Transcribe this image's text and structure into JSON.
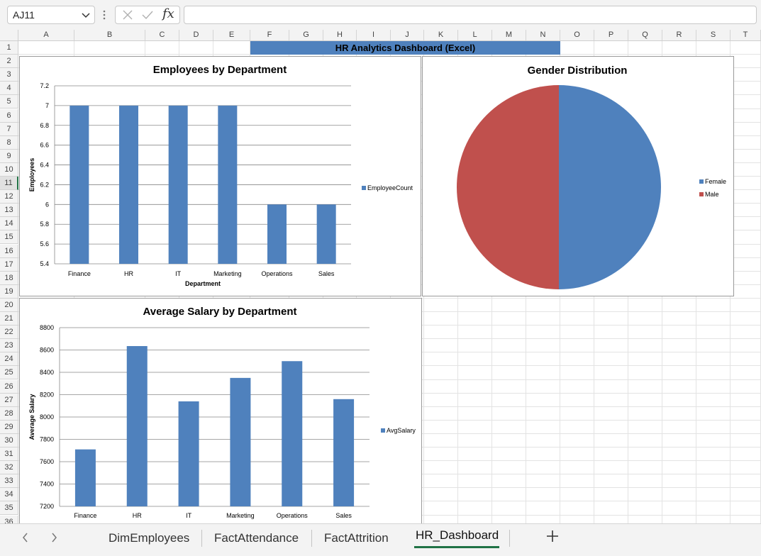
{
  "formula_bar": {
    "name_box": "AJ11",
    "fx_label": "fx",
    "formula": ""
  },
  "columns": [
    "A",
    "B",
    "C",
    "D",
    "E",
    "F",
    "G",
    "H",
    "I",
    "J",
    "K",
    "L",
    "M",
    "N",
    "O",
    "P",
    "Q",
    "R",
    "S",
    "T"
  ],
  "rows": [
    "1",
    "2",
    "3",
    "4",
    "5",
    "6",
    "7",
    "8",
    "9",
    "10",
    "11",
    "12",
    "13",
    "14",
    "15",
    "16",
    "17",
    "18",
    "19",
    "20",
    "21",
    "22",
    "23",
    "24",
    "25",
    "26",
    "27",
    "28",
    "29",
    "30",
    "31",
    "32",
    "33",
    "34",
    "35",
    "36"
  ],
  "selected_row": "11",
  "dashboard_title": "HR Analytics Dashboard (Excel)",
  "colors": {
    "series_blue": "#4f81bd",
    "series_red": "#c0504d",
    "title_fill": "#4f81bd",
    "excel_green": "#217346"
  },
  "charts": {
    "employees": {
      "title": "Employees by Department",
      "xlabel": "Department",
      "ylabel": "Employees",
      "legend": "EmployeeCount"
    },
    "gender": {
      "title": "Gender Distribution",
      "legend": [
        "Female",
        "Male"
      ]
    },
    "salary": {
      "title": "Average Salary by Department",
      "ylabel": "Average Salary",
      "legend": "AvgSalary"
    }
  },
  "chart_data": [
    {
      "type": "bar",
      "title": "Employees by Department",
      "xlabel": "Department",
      "ylabel": "Employees",
      "categories": [
        "Finance",
        "HR",
        "IT",
        "Marketing",
        "Operations",
        "Sales"
      ],
      "series": [
        {
          "name": "EmployeeCount",
          "values": [
            7,
            7,
            7,
            7,
            6,
            6
          ]
        }
      ],
      "ylim": [
        5.4,
        7.2
      ],
      "yticks": [
        "5.4",
        "5.6",
        "5.8",
        "6",
        "6.2",
        "6.4",
        "6.6",
        "6.8",
        "7",
        "7.2"
      ],
      "grid": true,
      "legend_position": "right",
      "color": "#4f81bd"
    },
    {
      "type": "pie",
      "title": "Gender Distribution",
      "categories": [
        "Female",
        "Male"
      ],
      "values": [
        50,
        50
      ],
      "colors": [
        "#4f81bd",
        "#c0504d"
      ],
      "legend_position": "right"
    },
    {
      "type": "bar",
      "title": "Average Salary by Department",
      "xlabel": "",
      "ylabel": "Average Salary",
      "categories": [
        "Finance",
        "HR",
        "IT",
        "Marketing",
        "Operations",
        "Sales"
      ],
      "series": [
        {
          "name": "AvgSalary",
          "values": [
            7710,
            8635,
            8140,
            8350,
            8500,
            8160
          ]
        }
      ],
      "ylim": [
        7200,
        8800
      ],
      "yticks": [
        "7200",
        "7400",
        "7600",
        "7800",
        "8000",
        "8200",
        "8400",
        "8600",
        "8800"
      ],
      "grid": true,
      "legend_position": "right",
      "color": "#4f81bd"
    }
  ],
  "sheet_tabs": {
    "tabs": [
      "DimEmployees",
      "FactAttendance",
      "FactAttrition",
      "HR_Dashboard"
    ],
    "active": "HR_Dashboard",
    "add_label": "+"
  }
}
